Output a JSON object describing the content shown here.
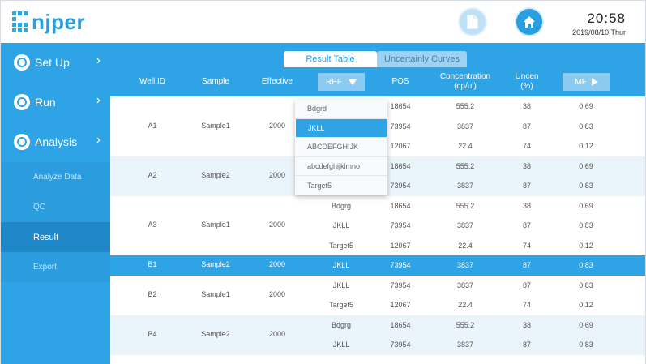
{
  "header": {
    "logo_text": "njper",
    "time": "20:58",
    "date": "2019/08/10 Thur",
    "icons": {
      "report": "document-icon",
      "home": "home-icon"
    }
  },
  "sidebar": {
    "main": [
      {
        "label": "Set Up",
        "icon": "settings-icon"
      },
      {
        "label": "Run",
        "icon": "refresh-icon"
      },
      {
        "label": "Analysis",
        "icon": "check-icon"
      }
    ],
    "sub": [
      {
        "label": "Analyze Data",
        "active": false
      },
      {
        "label": "QC",
        "active": false
      },
      {
        "label": "Result",
        "active": true
      },
      {
        "label": "Export",
        "active": false
      }
    ]
  },
  "tabs": {
    "result": "Result Table",
    "uncertainty": "Uncertainly Curves"
  },
  "columns": {
    "well": "Well ID",
    "sample": "Sample",
    "effective": "Effective",
    "ref": "REF",
    "pos": "POS",
    "conc_l1": "Concentration",
    "conc_l2": "(cp/ul)",
    "unc_l1": "Uncen",
    "unc_l2": "(%)",
    "mf": "MF"
  },
  "dropdown": {
    "items": [
      "Bdgrd",
      "JKLL",
      "ABCDEFGHIJK",
      "abcdefghijklmno",
      "Target5"
    ],
    "selected_index": 1
  },
  "groups": [
    {
      "well": "A1",
      "sample": "Sample1",
      "effective": "2000",
      "style": "plain",
      "rows": [
        {
          "ref": "Bdgrg",
          "pos": "18654",
          "conc": "555.2",
          "unc": "38",
          "mf": "0.69"
        },
        {
          "ref": "JKLL",
          "pos": "73954",
          "conc": "3837",
          "unc": "87",
          "mf": "0.83"
        },
        {
          "ref": "Target5",
          "pos": "12067",
          "conc": "22.4",
          "unc": "74",
          "mf": "0.12"
        }
      ]
    },
    {
      "well": "A2",
      "sample": "Sample2",
      "effective": "2000",
      "style": "alt",
      "rows": [
        {
          "ref": "Bdgrg",
          "pos": "18654",
          "conc": "555.2",
          "unc": "38",
          "mf": "0.69"
        },
        {
          "ref": "JKLL",
          "pos": "73954",
          "conc": "3837",
          "unc": "87",
          "mf": "0.83"
        }
      ]
    },
    {
      "well": "A3",
      "sample": "Sample1",
      "effective": "2000",
      "style": "plain",
      "rows": [
        {
          "ref": "Bdgrg",
          "pos": "18654",
          "conc": "555.2",
          "unc": "38",
          "mf": "0.69"
        },
        {
          "ref": "JKLL",
          "pos": "73954",
          "conc": "3837",
          "unc": "87",
          "mf": "0.83"
        },
        {
          "ref": "Target5",
          "pos": "12067",
          "conc": "22.4",
          "unc": "74",
          "mf": "0.12"
        }
      ]
    },
    {
      "well": "B1",
      "sample": "Sample2",
      "effective": "2000",
      "style": "selected",
      "rows": [
        {
          "ref": "JKLL",
          "pos": "73954",
          "conc": "3837",
          "unc": "87",
          "mf": "0.83"
        }
      ]
    },
    {
      "well": "B2",
      "sample": "Sample1",
      "effective": "2000",
      "style": "plain",
      "rows": [
        {
          "ref": "JKLL",
          "pos": "73954",
          "conc": "3837",
          "unc": "87",
          "mf": "0.83"
        },
        {
          "ref": "Target5",
          "pos": "12067",
          "conc": "22.4",
          "unc": "74",
          "mf": "0.12"
        }
      ]
    },
    {
      "well": "B4",
      "sample": "Sample2",
      "effective": "2000",
      "style": "alt",
      "rows": [
        {
          "ref": "Bdgrg",
          "pos": "18654",
          "conc": "555.2",
          "unc": "38",
          "mf": "0.69"
        },
        {
          "ref": "JKLL",
          "pos": "73954",
          "conc": "3837",
          "unc": "87",
          "mf": "0.83"
        }
      ]
    }
  ],
  "colors": {
    "primary": "#2ea3e6",
    "selected_sub": "#1f86c8",
    "alt_row": "#eaf4fb"
  }
}
